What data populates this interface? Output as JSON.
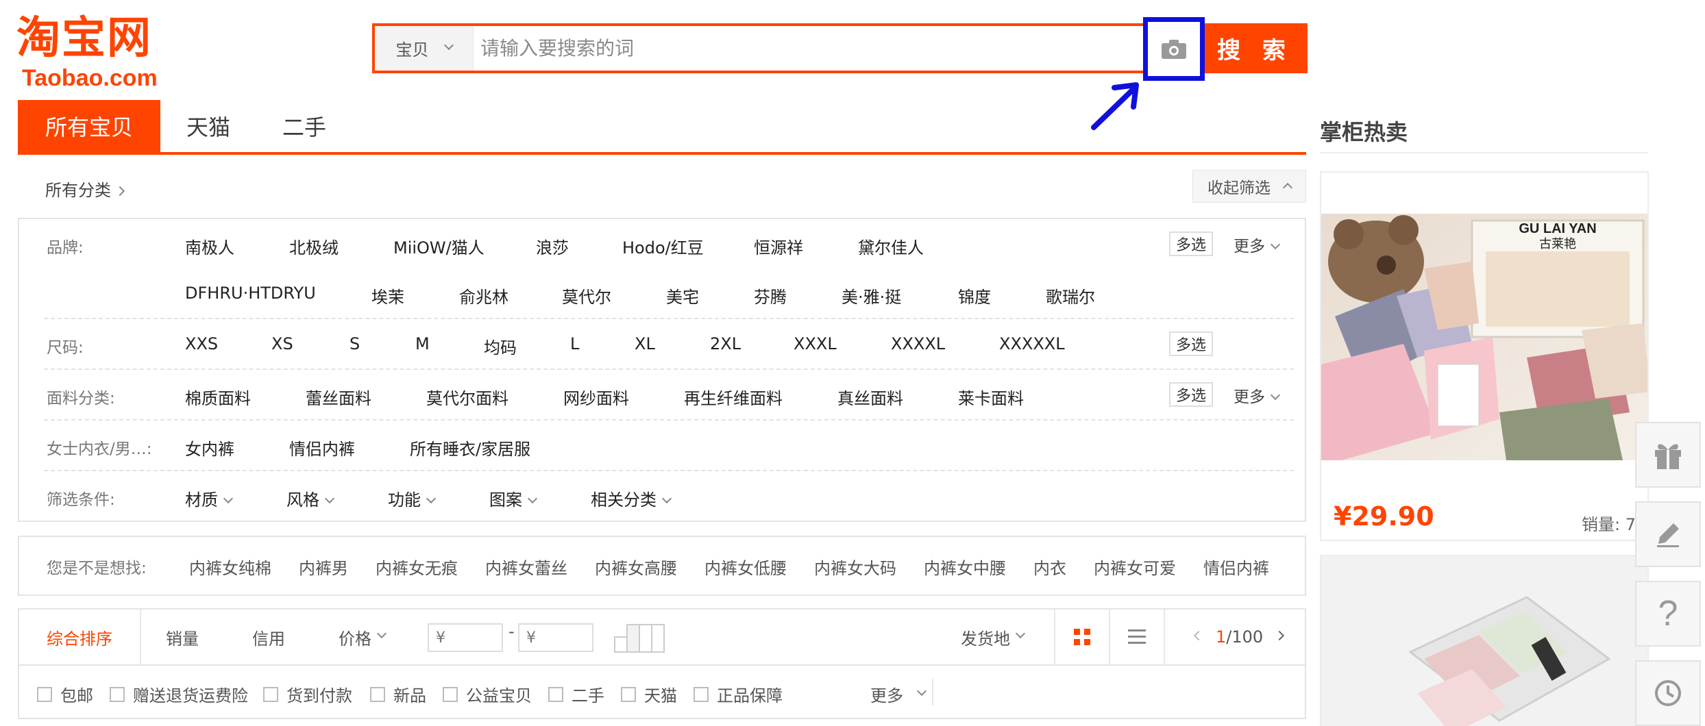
{
  "logo": {
    "cn": "淘宝网",
    "en": "Taobao.com"
  },
  "search": {
    "type_label": "宝贝",
    "placeholder": "请输入要搜索的词",
    "button_label": "搜 索"
  },
  "tabs": [
    {
      "label": "所有宝贝"
    },
    {
      "label": "天猫"
    },
    {
      "label": "二手"
    }
  ],
  "shopkeeper": {
    "title": "掌柜热卖",
    "product_brand_en": "GU LAI YAN",
    "product_brand_cn": "古莱艳",
    "price": "¥29.90",
    "sales": "销量: 7"
  },
  "breadcrumb": {
    "label": "所有分类"
  },
  "collapse_label": "收起筛选",
  "filters": {
    "brand_label": "品牌:",
    "brands_row1": [
      "南极人",
      "北极绒",
      "MiiOW/猫人",
      "浪莎",
      "Hodo/红豆",
      "恒源祥",
      "黛尔佳人"
    ],
    "brands_row2": [
      "DFHRU·HTDRYU",
      "埃茉",
      "俞兆林",
      "莫代尔",
      "美宅",
      "芬腾",
      "美·雅·挺",
      "锦度",
      "歌瑞尔"
    ],
    "size_label": "尺码:",
    "sizes": [
      "XXS",
      "XS",
      "S",
      "M",
      "均码",
      "L",
      "XL",
      "2XL",
      "XXXL",
      "XXXXL",
      "XXXXXL"
    ],
    "fabric_label": "面料分类:",
    "fabrics": [
      "棉质面料",
      "蕾丝面料",
      "莫代尔面料",
      "网纱面料",
      "再生纤维面料",
      "真丝面料",
      "莱卡面料"
    ],
    "underwear_label": "女士内衣/男…:",
    "underwear": [
      "女内裤",
      "情侣内裤",
      "所有睡衣/家居服"
    ],
    "conditions_label": "筛选条件:",
    "conditions": [
      "材质",
      "风格",
      "功能",
      "图案",
      "相关分类"
    ],
    "multi_label": "多选",
    "more_label": "更多"
  },
  "suggest": {
    "label": "您是不是想找:",
    "items": [
      "内裤女纯棉",
      "内裤男",
      "内裤女无痕",
      "内裤女蕾丝",
      "内裤女高腰",
      "内裤女低腰",
      "内裤女大码",
      "内裤女中腰",
      "内衣",
      "内裤女可爱",
      "情侣内裤"
    ]
  },
  "sort": {
    "items": [
      "综合排序",
      "销量",
      "信用",
      "价格"
    ],
    "price_from": "¥",
    "price_to": "¥",
    "price_dash": "-",
    "ship_from": "发货地",
    "page_current": "1",
    "page_total": "/100"
  },
  "checks": [
    "包邮",
    "赠送退货运费险",
    "货到付款",
    "新品",
    "公益宝贝",
    "二手",
    "天猫",
    "正品保障"
  ],
  "checks_more": "更多",
  "colors": {
    "accent": "#ff4400",
    "highlight": "#1010dd"
  },
  "icons": [
    "camera-icon",
    "gift-icon",
    "edit-icon",
    "help-icon",
    "clock-icon",
    "grid-view-icon",
    "list-view-icon"
  ]
}
